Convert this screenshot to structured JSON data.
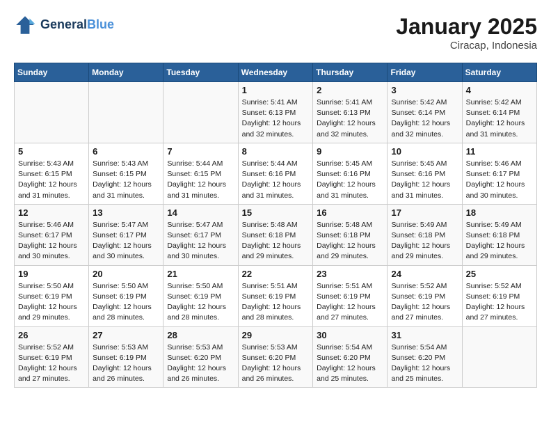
{
  "header": {
    "logo_general": "General",
    "logo_blue": "Blue",
    "month": "January 2025",
    "location": "Ciracap, Indonesia"
  },
  "weekdays": [
    "Sunday",
    "Monday",
    "Tuesday",
    "Wednesday",
    "Thursday",
    "Friday",
    "Saturday"
  ],
  "weeks": [
    [
      {
        "day": "",
        "info": ""
      },
      {
        "day": "",
        "info": ""
      },
      {
        "day": "",
        "info": ""
      },
      {
        "day": "1",
        "info": "Sunrise: 5:41 AM\nSunset: 6:13 PM\nDaylight: 12 hours\nand 32 minutes."
      },
      {
        "day": "2",
        "info": "Sunrise: 5:41 AM\nSunset: 6:13 PM\nDaylight: 12 hours\nand 32 minutes."
      },
      {
        "day": "3",
        "info": "Sunrise: 5:42 AM\nSunset: 6:14 PM\nDaylight: 12 hours\nand 32 minutes."
      },
      {
        "day": "4",
        "info": "Sunrise: 5:42 AM\nSunset: 6:14 PM\nDaylight: 12 hours\nand 31 minutes."
      }
    ],
    [
      {
        "day": "5",
        "info": "Sunrise: 5:43 AM\nSunset: 6:15 PM\nDaylight: 12 hours\nand 31 minutes."
      },
      {
        "day": "6",
        "info": "Sunrise: 5:43 AM\nSunset: 6:15 PM\nDaylight: 12 hours\nand 31 minutes."
      },
      {
        "day": "7",
        "info": "Sunrise: 5:44 AM\nSunset: 6:15 PM\nDaylight: 12 hours\nand 31 minutes."
      },
      {
        "day": "8",
        "info": "Sunrise: 5:44 AM\nSunset: 6:16 PM\nDaylight: 12 hours\nand 31 minutes."
      },
      {
        "day": "9",
        "info": "Sunrise: 5:45 AM\nSunset: 6:16 PM\nDaylight: 12 hours\nand 31 minutes."
      },
      {
        "day": "10",
        "info": "Sunrise: 5:45 AM\nSunset: 6:16 PM\nDaylight: 12 hours\nand 31 minutes."
      },
      {
        "day": "11",
        "info": "Sunrise: 5:46 AM\nSunset: 6:17 PM\nDaylight: 12 hours\nand 30 minutes."
      }
    ],
    [
      {
        "day": "12",
        "info": "Sunrise: 5:46 AM\nSunset: 6:17 PM\nDaylight: 12 hours\nand 30 minutes."
      },
      {
        "day": "13",
        "info": "Sunrise: 5:47 AM\nSunset: 6:17 PM\nDaylight: 12 hours\nand 30 minutes."
      },
      {
        "day": "14",
        "info": "Sunrise: 5:47 AM\nSunset: 6:17 PM\nDaylight: 12 hours\nand 30 minutes."
      },
      {
        "day": "15",
        "info": "Sunrise: 5:48 AM\nSunset: 6:18 PM\nDaylight: 12 hours\nand 29 minutes."
      },
      {
        "day": "16",
        "info": "Sunrise: 5:48 AM\nSunset: 6:18 PM\nDaylight: 12 hours\nand 29 minutes."
      },
      {
        "day": "17",
        "info": "Sunrise: 5:49 AM\nSunset: 6:18 PM\nDaylight: 12 hours\nand 29 minutes."
      },
      {
        "day": "18",
        "info": "Sunrise: 5:49 AM\nSunset: 6:18 PM\nDaylight: 12 hours\nand 29 minutes."
      }
    ],
    [
      {
        "day": "19",
        "info": "Sunrise: 5:50 AM\nSunset: 6:19 PM\nDaylight: 12 hours\nand 29 minutes."
      },
      {
        "day": "20",
        "info": "Sunrise: 5:50 AM\nSunset: 6:19 PM\nDaylight: 12 hours\nand 28 minutes."
      },
      {
        "day": "21",
        "info": "Sunrise: 5:50 AM\nSunset: 6:19 PM\nDaylight: 12 hours\nand 28 minutes."
      },
      {
        "day": "22",
        "info": "Sunrise: 5:51 AM\nSunset: 6:19 PM\nDaylight: 12 hours\nand 28 minutes."
      },
      {
        "day": "23",
        "info": "Sunrise: 5:51 AM\nSunset: 6:19 PM\nDaylight: 12 hours\nand 27 minutes."
      },
      {
        "day": "24",
        "info": "Sunrise: 5:52 AM\nSunset: 6:19 PM\nDaylight: 12 hours\nand 27 minutes."
      },
      {
        "day": "25",
        "info": "Sunrise: 5:52 AM\nSunset: 6:19 PM\nDaylight: 12 hours\nand 27 minutes."
      }
    ],
    [
      {
        "day": "26",
        "info": "Sunrise: 5:52 AM\nSunset: 6:19 PM\nDaylight: 12 hours\nand 27 minutes."
      },
      {
        "day": "27",
        "info": "Sunrise: 5:53 AM\nSunset: 6:19 PM\nDaylight: 12 hours\nand 26 minutes."
      },
      {
        "day": "28",
        "info": "Sunrise: 5:53 AM\nSunset: 6:20 PM\nDaylight: 12 hours\nand 26 minutes."
      },
      {
        "day": "29",
        "info": "Sunrise: 5:53 AM\nSunset: 6:20 PM\nDaylight: 12 hours\nand 26 minutes."
      },
      {
        "day": "30",
        "info": "Sunrise: 5:54 AM\nSunset: 6:20 PM\nDaylight: 12 hours\nand 25 minutes."
      },
      {
        "day": "31",
        "info": "Sunrise: 5:54 AM\nSunset: 6:20 PM\nDaylight: 12 hours\nand 25 minutes."
      },
      {
        "day": "",
        "info": ""
      }
    ]
  ]
}
